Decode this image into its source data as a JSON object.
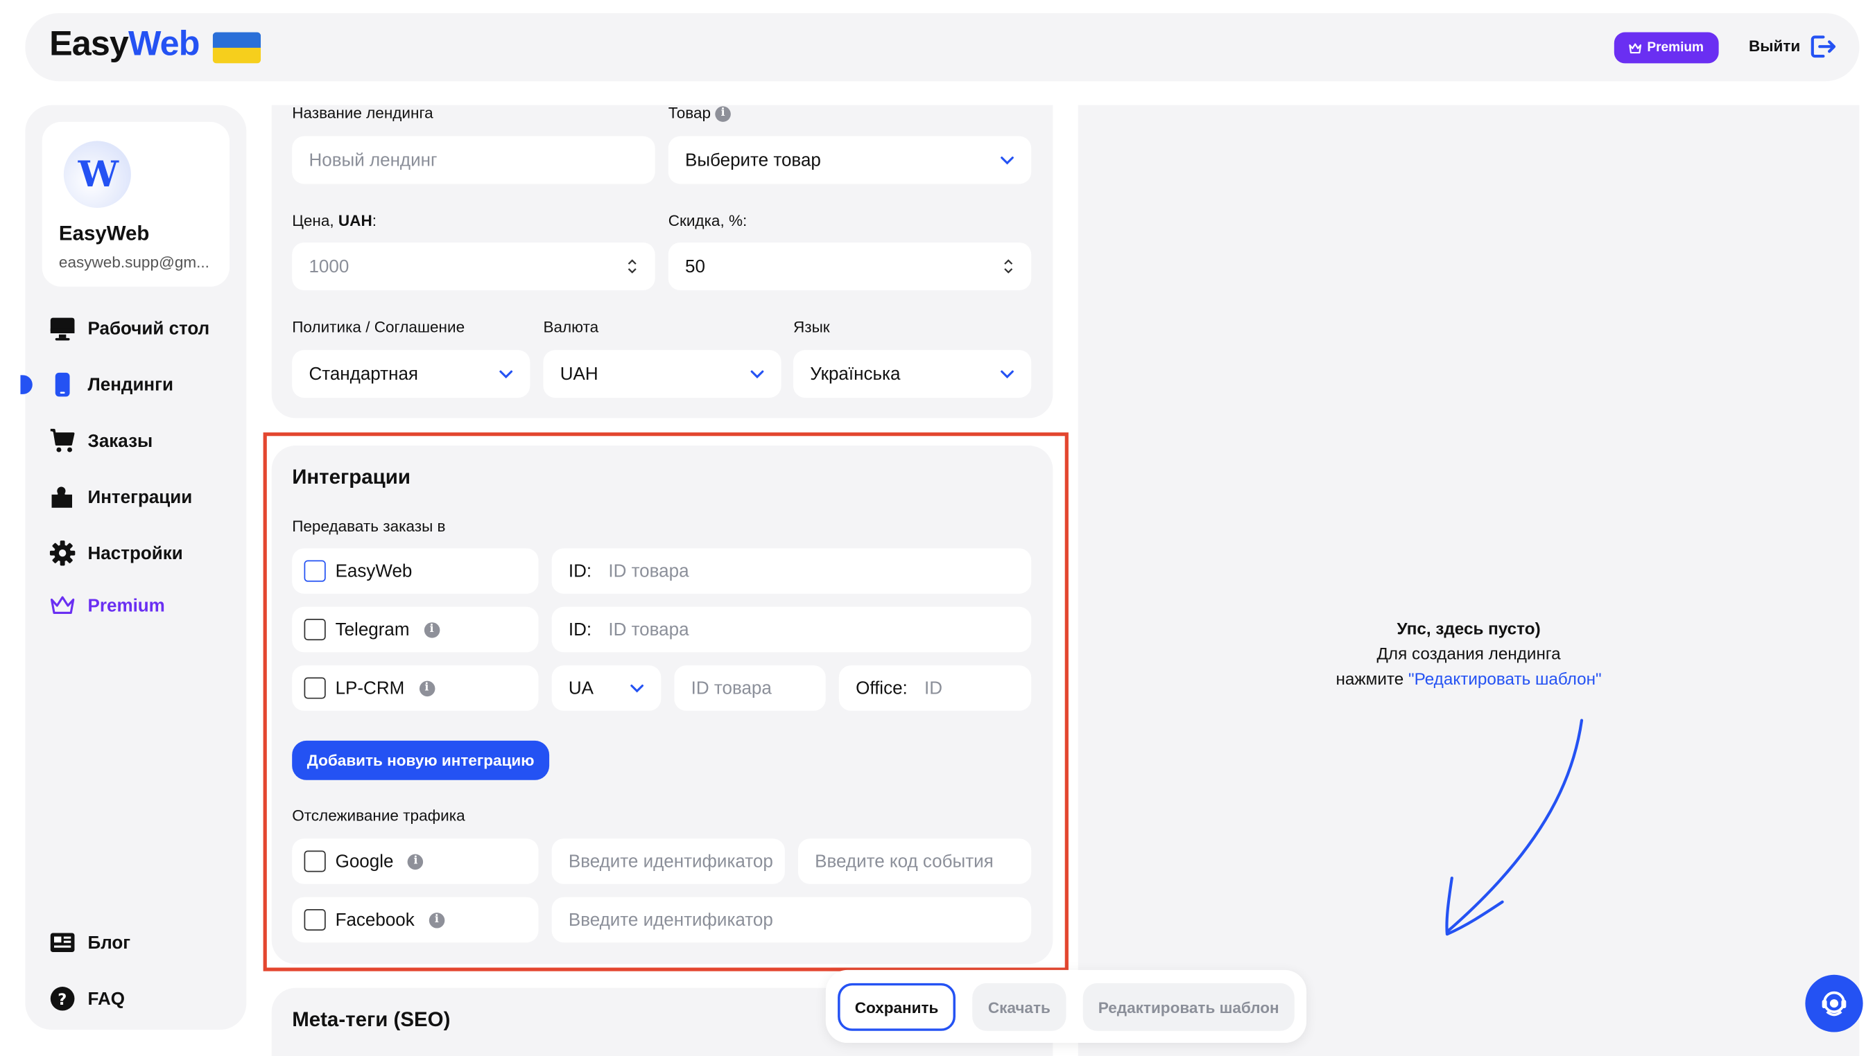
{
  "header": {
    "logo_part1": "Easy",
    "logo_part2": "Web",
    "premium_label": "Premium",
    "logout_label": "Выйти"
  },
  "profile": {
    "name": "EasyWeb",
    "email": "easyweb.supp@gm..."
  },
  "sidebar": {
    "items": [
      {
        "label": "Рабочий стол",
        "icon": "monitor-icon"
      },
      {
        "label": "Лендинги",
        "icon": "phone-icon"
      },
      {
        "label": "Заказы",
        "icon": "cart-icon"
      },
      {
        "label": "Интеграции",
        "icon": "puzzle-icon"
      },
      {
        "label": "Настройки",
        "icon": "gear-icon"
      },
      {
        "label": "Premium",
        "icon": "crown-icon"
      }
    ],
    "bottom": [
      {
        "label": "Блог",
        "icon": "news-icon"
      },
      {
        "label": "FAQ",
        "icon": "question-icon"
      }
    ]
  },
  "form": {
    "landing_name_label": "Название лендинга",
    "landing_name_placeholder": "Новый лендинг",
    "product_label": "Товар",
    "product_value": "Выберите товар",
    "price_label_prefix": "Цена, ",
    "price_label_unit": "UAH",
    "price_label_suffix": ":",
    "price_placeholder": "1000",
    "discount_label": "Скидка, %:",
    "discount_value": "50",
    "policy_label": "Политика / Соглашение",
    "policy_value": "Стандартная",
    "currency_label": "Валюта",
    "currency_value": "UAH",
    "language_label": "Язык",
    "language_value": "Українська"
  },
  "integrations": {
    "title": "Интеграции",
    "send_label": "Передавать заказы в",
    "rows": [
      {
        "name": "EasyWeb",
        "id_label": "ID:",
        "id_placeholder": "ID товара"
      },
      {
        "name": "Telegram",
        "id_label": "ID:",
        "id_placeholder": "ID товара"
      }
    ],
    "lpcrm": {
      "name": "LP-CRM",
      "country": "UA",
      "id_placeholder": "ID товара",
      "office_label": "Office:",
      "office_placeholder": "ID"
    },
    "add_button": "Добавить новую интеграцию",
    "tracking_label": "Отслеживание трафика",
    "google": {
      "name": "Google",
      "id_placeholder": "Введите идентификатор",
      "event_placeholder": "Введите код события"
    },
    "facebook": {
      "name": "Facebook",
      "id_placeholder": "Введите идентификатор"
    }
  },
  "meta": {
    "title": "Meta-теги (SEO)"
  },
  "empty_state": {
    "line1": "Упс, здесь пусто)",
    "line2": "Для создания лендинга",
    "line3_prefix": "нажмите ",
    "line3_link": "\"Редактировать шаблон\""
  },
  "actions": {
    "save": "Сохранить",
    "download": "Скачать",
    "edit": "Редактировать шаблон"
  },
  "colors": {
    "brand_blue": "#2452f3",
    "premium_purple": "#6a2ff2",
    "highlight_red": "#e3462f"
  }
}
